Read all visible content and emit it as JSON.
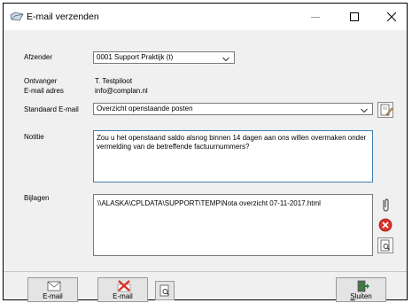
{
  "window": {
    "title": "E-mail verzenden"
  },
  "form": {
    "afzender_label": "Afzender",
    "afzender_value": "0001 Support Praktijk (t)",
    "ontvanger_label": "Ontvanger",
    "ontvanger_value": "T. Testpiloot",
    "email_label": "E-mail adres",
    "email_value": "info@complan.nl",
    "standaard_label": "Standaard E-mail",
    "standaard_value": "Overzicht openstaande posten",
    "notitie_label": "Notitie",
    "notitie_value": "Zou u het openstaand saldo alsnog binnen 14 dagen aan ons willen overmaken onder vermelding van de betreffende factuurnummers?",
    "bijlagen_label": "Bijlagen",
    "bijlagen_items": [
      "\\\\ALASKA\\CPLDATA\\SUPPORT\\TEMP\\Nota overzicht 07-11-2017.html"
    ]
  },
  "buttons": {
    "email_send_label": "E-mail",
    "email_cancel_label": "E-mail",
    "close_mnemonic": "S",
    "close_rest": "luiten"
  },
  "icons": {
    "app": "email-icon",
    "template_edit": "edit-document-icon",
    "attach": "paperclip-icon",
    "remove": "red-x-circle-icon",
    "preview": "magnifier-document-icon",
    "send": "envelope-icon",
    "cancel": "red-x-envelope-icon",
    "exit": "exit-door-icon"
  },
  "colors": {
    "focus_border": "#3c7fb1",
    "remove_red": "#d9332a"
  }
}
